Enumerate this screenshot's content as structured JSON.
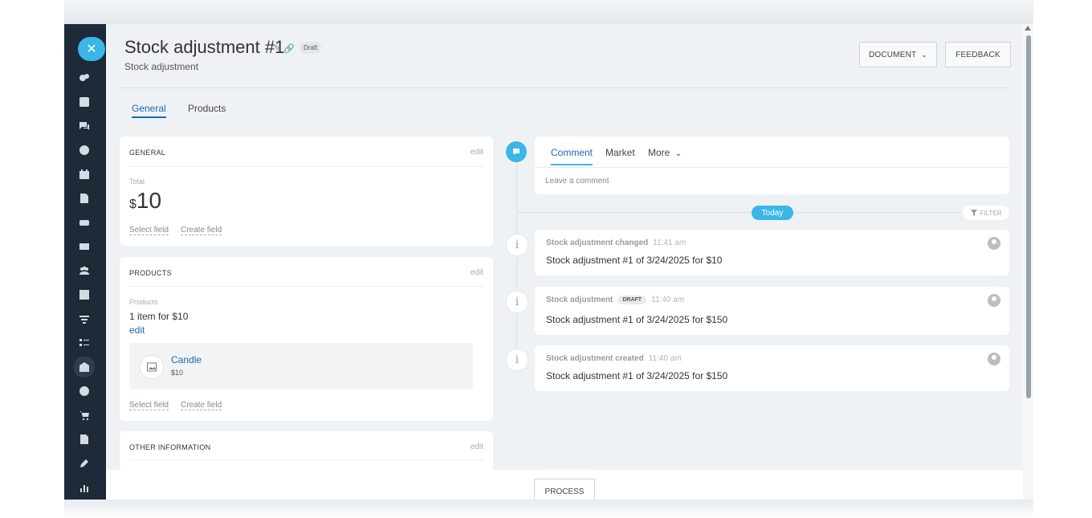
{
  "header": {
    "title": "Stock adjustment #1",
    "badge": "Draft",
    "subtitle": "Stock adjustment",
    "document_label": "DOCUMENT",
    "feedback_label": "FEEDBACK"
  },
  "tabs": [
    "General",
    "Products"
  ],
  "general": {
    "heading": "GENERAL",
    "edit": "edit",
    "total_label": "Total",
    "currency": "$",
    "amount": "10",
    "select_field": "Select field",
    "create_field": "Create field"
  },
  "products": {
    "heading": "PRODUCTS",
    "edit": "edit",
    "label": "Products",
    "summary": "1 item for $10",
    "edit_link": "edit",
    "item_name": "Candle",
    "item_price": "$10",
    "select_field": "Select field",
    "create_field": "Create field"
  },
  "other": {
    "heading": "OTHER INFORMATION",
    "edit": "edit"
  },
  "timeline": {
    "tabs": [
      "Comment",
      "Market",
      "More"
    ],
    "placeholder": "Leave a comment",
    "today": "Today",
    "filter": "FILTER",
    "events": [
      {
        "title": "Stock adjustment changed",
        "badge": "",
        "time": "11:41 am",
        "detail": "Stock adjustment #1 of 3/24/2025 for $10"
      },
      {
        "title": "Stock adjustment",
        "badge": "DRAFT",
        "time": "11:40 am",
        "detail": "Stock adjustment #1 of 3/24/2025 for $150"
      },
      {
        "title": "Stock adjustment created",
        "badge": "",
        "time": "11:40 am",
        "detail": "Stock adjustment #1 of 3/24/2025 for $150"
      }
    ]
  },
  "footer": {
    "process_label": "PROCESS"
  },
  "colors": {
    "accent": "#3bb6e6",
    "link": "#2067b0",
    "sidebar": "#1e2a38"
  }
}
